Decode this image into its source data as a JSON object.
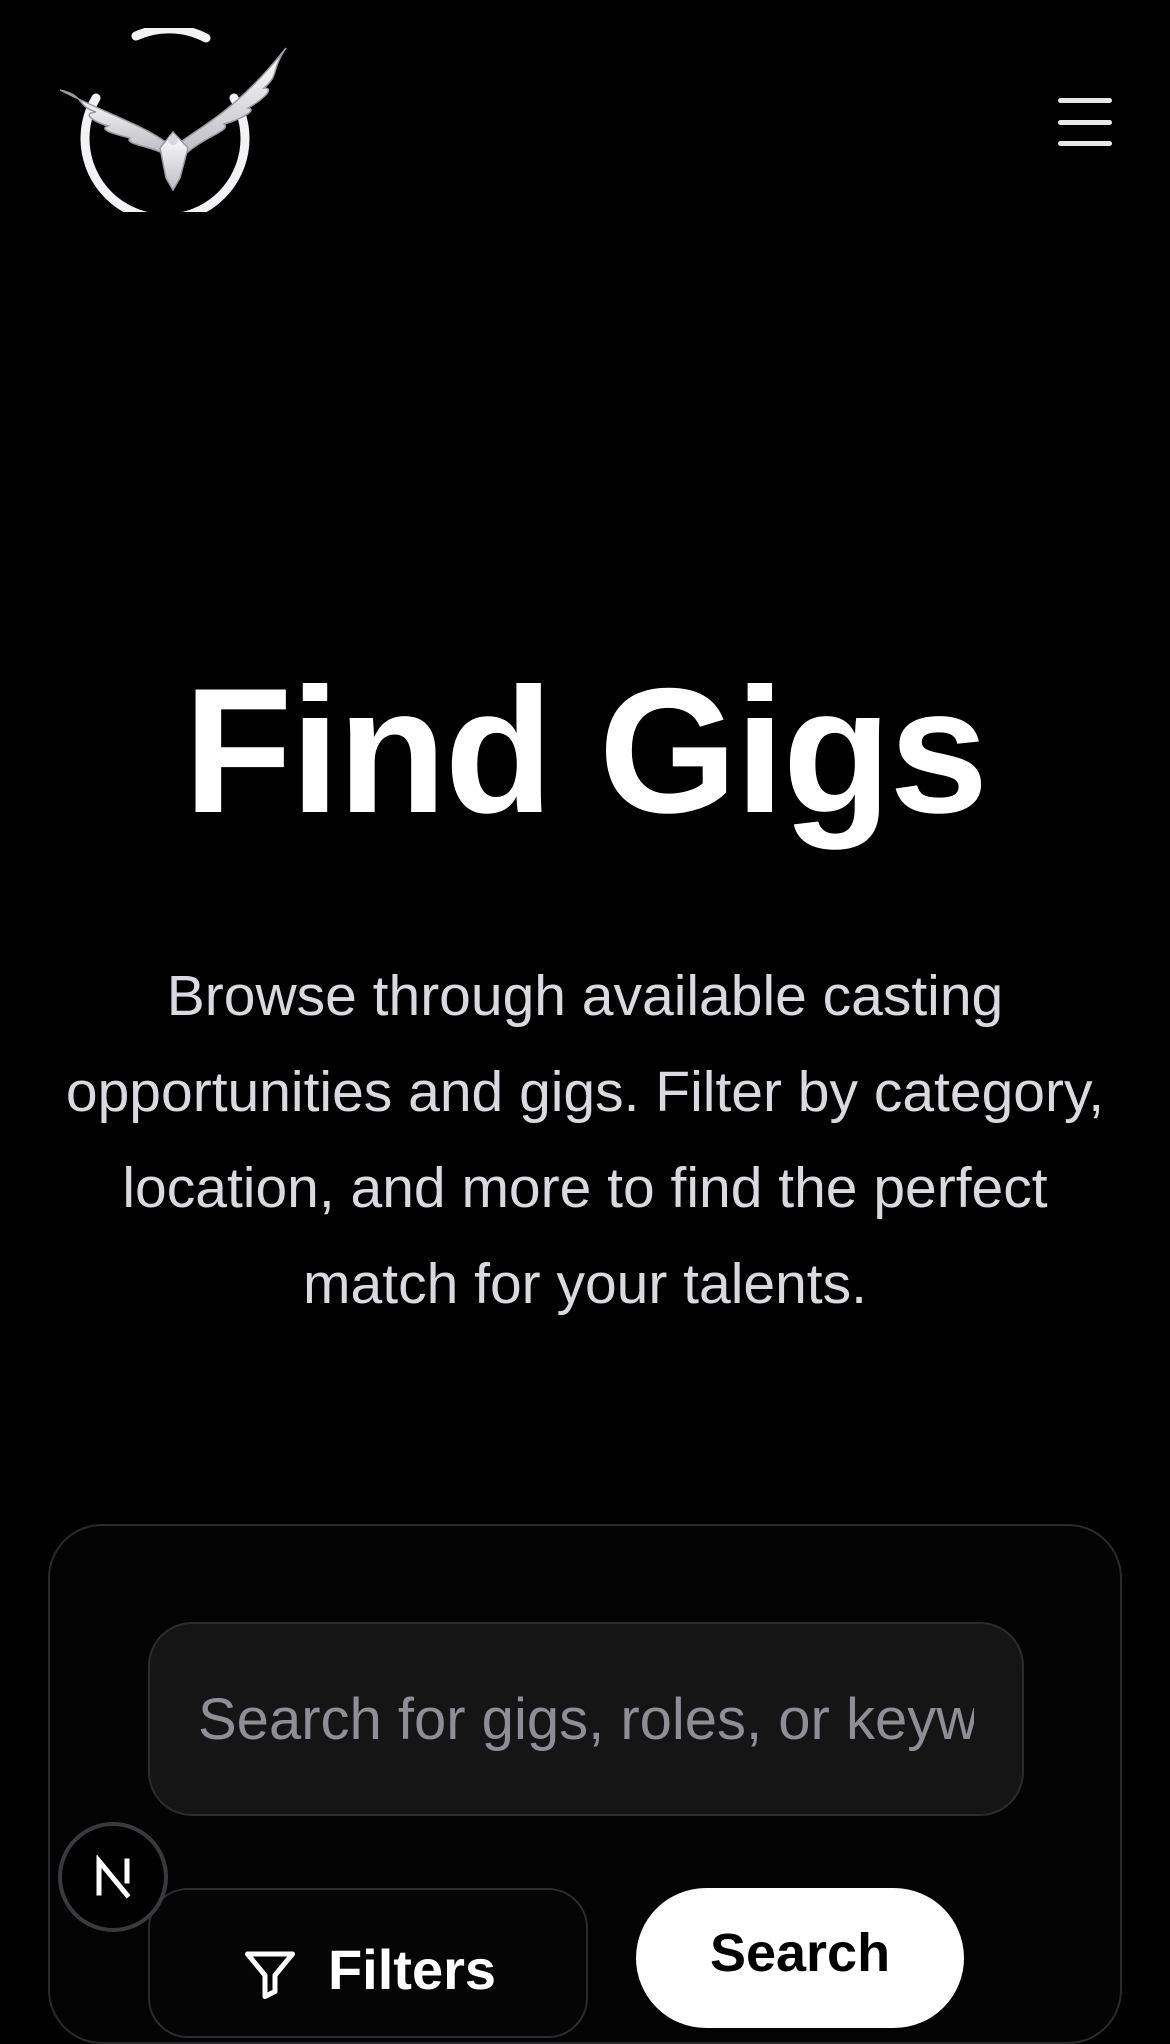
{
  "header": {
    "logo_icon": "eagle-circle-logo-icon",
    "menu_icon": "hamburger-menu-icon"
  },
  "hero": {
    "title": "Find Gigs",
    "description": "Browse through available casting opportunities and gigs. Filter by category, location, and more to find the perfect match for your talents."
  },
  "search": {
    "placeholder": "Search for gigs, roles, or keywords",
    "value": "",
    "filters_label": "Filters",
    "filters_icon": "funnel-filter-icon",
    "search_label": "Search"
  },
  "dev_badge": {
    "icon": "nextjs-n-icon"
  },
  "colors": {
    "background": "#000000",
    "text": "#ffffff",
    "muted_text": "#d9d9de",
    "input_bg": "#151516",
    "border": "#2c2c30",
    "primary_button_bg": "#ffffff",
    "primary_button_text": "#000000"
  }
}
